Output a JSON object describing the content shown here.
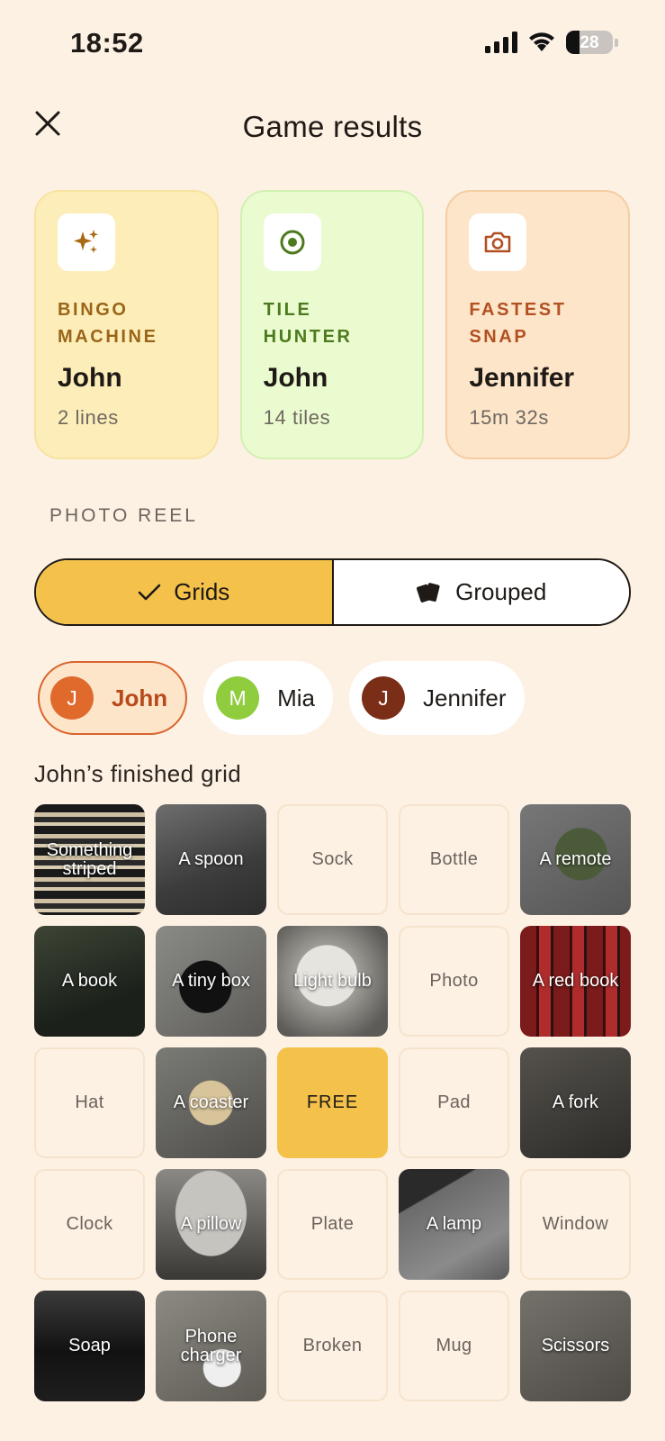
{
  "status": {
    "time": "18:52",
    "battery": "28"
  },
  "header": {
    "title": "Game results"
  },
  "awards": [
    {
      "label": "BINGO MACHINE",
      "name": "John",
      "stat": "2 lines",
      "icon": "sparkles-icon"
    },
    {
      "label": "TILE HUNTER",
      "name": "John",
      "stat": "14 tiles",
      "icon": "target-icon"
    },
    {
      "label": "FASTEST SNAP",
      "name": "Jennifer",
      "stat": "15m 32s",
      "icon": "camera-icon"
    }
  ],
  "photo_reel": {
    "label": "PHOTO REEL",
    "views": [
      {
        "label": "Grids",
        "selected": true
      },
      {
        "label": "Grouped",
        "selected": false
      }
    ]
  },
  "players": [
    {
      "initial": "J",
      "name": "John",
      "color": "#e06a2c",
      "selected": true
    },
    {
      "initial": "M",
      "name": "Mia",
      "color": "#8fcc3e",
      "selected": false
    },
    {
      "initial": "J",
      "name": "Jennifer",
      "color": "#7a2d17",
      "selected": false
    }
  ],
  "grid": {
    "title": "John’s finished grid",
    "cells": [
      {
        "label": "Something striped",
        "state": "photo"
      },
      {
        "label": "A spoon",
        "state": "photo"
      },
      {
        "label": "Sock",
        "state": "empty"
      },
      {
        "label": "Bottle",
        "state": "empty"
      },
      {
        "label": "A remote",
        "state": "photo"
      },
      {
        "label": "A book",
        "state": "photo"
      },
      {
        "label": "A tiny box",
        "state": "photo"
      },
      {
        "label": "Light bulb",
        "state": "photo"
      },
      {
        "label": "Photo",
        "state": "empty"
      },
      {
        "label": "A red book",
        "state": "photo"
      },
      {
        "label": "Hat",
        "state": "empty"
      },
      {
        "label": "A coaster",
        "state": "photo"
      },
      {
        "label": "FREE",
        "state": "free"
      },
      {
        "label": "Pad",
        "state": "empty"
      },
      {
        "label": "A fork",
        "state": "photo"
      },
      {
        "label": "Clock",
        "state": "empty"
      },
      {
        "label": "A pillow",
        "state": "photo"
      },
      {
        "label": "Plate",
        "state": "empty"
      },
      {
        "label": "A lamp",
        "state": "photo"
      },
      {
        "label": "Window",
        "state": "empty"
      },
      {
        "label": "Soap",
        "state": "photo"
      },
      {
        "label": "Phone charger",
        "state": "photo"
      },
      {
        "label": "Broken",
        "state": "empty"
      },
      {
        "label": "Mug",
        "state": "empty"
      },
      {
        "label": "Scissors",
        "state": "photo"
      }
    ]
  }
}
